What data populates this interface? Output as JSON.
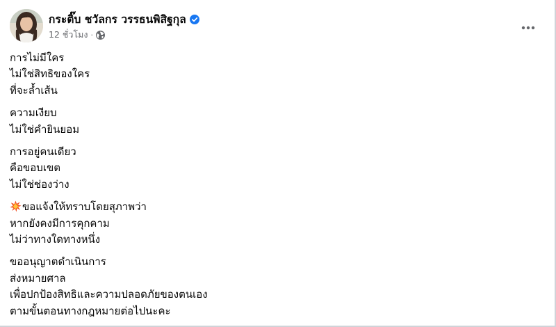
{
  "post": {
    "author_name": "กระติ๊บ ชวัลกร วรรธนพิสิฐกุล",
    "time_text": "12 ชั่วโมง",
    "meta_separator": "·",
    "verified_icon": "verified-badge-icon",
    "privacy_icon": "globe-icon",
    "more_icon": "more-horizontal-icon",
    "accent_color": "#1877f2",
    "paragraphs": [
      [
        "การไม่มีใคร",
        "ไม่ใช่สิทธิของใคร",
        "ที่จะล้ำเส้น"
      ],
      [
        "ความเงียบ",
        "ไม่ใช่คำยินยอม"
      ],
      [
        "การอยู่คนเดียว",
        "คือขอบเขต",
        "ไม่ใช่ช่องว่าง"
      ],
      [
        "ขอแจ้งให้ทราบโดยสุภาพว่า",
        "หากยังคงมีการคุกคาม",
        "ไม่ว่าทางใดทางหนึ่ง"
      ],
      [
        "ขออนุญาตดำเนินการ",
        "ส่งหมายศาล",
        "เพื่อปกป้องสิทธิและความปลอดภัยของตนเอง",
        "ตามขั้นตอนทางกฎหมายต่อไปนะคะ"
      ]
    ],
    "paragraph4_leading_emoji": "collision-emoji"
  }
}
